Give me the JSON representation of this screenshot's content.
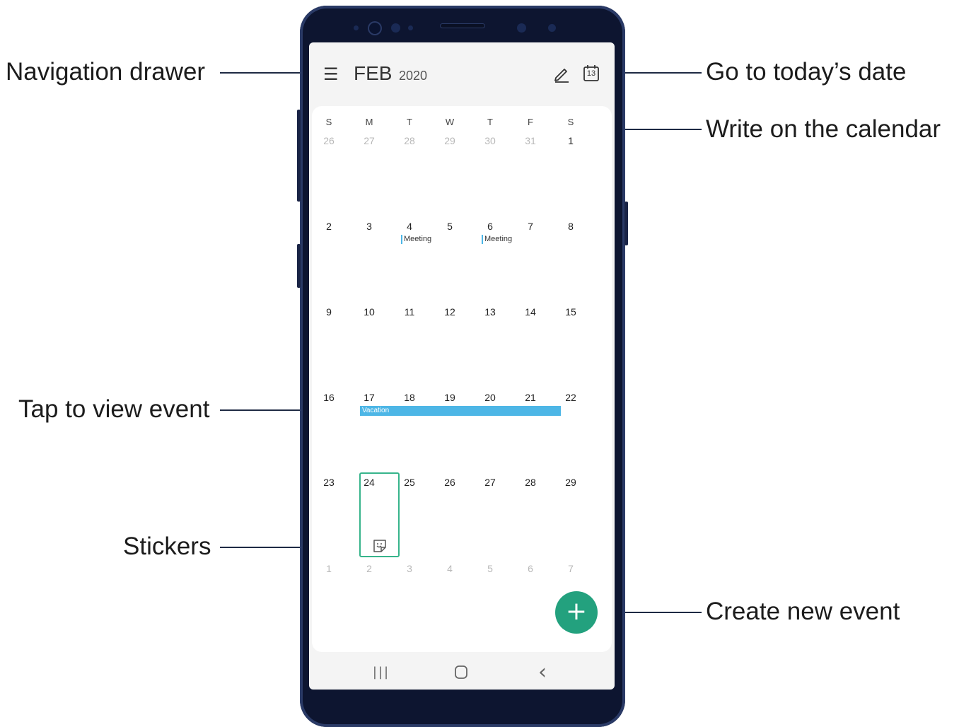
{
  "callouts": {
    "navigation_drawer": "Navigation drawer",
    "go_to_today": "Go to today’s date",
    "write_on_calendar": "Write on the calendar",
    "tap_to_view_event": "Tap to view event",
    "stickers": "Stickers",
    "create_new_event": "Create new event"
  },
  "header": {
    "menu_icon": "☰",
    "month": "FEB",
    "year": "2020",
    "today_icon_number": "13"
  },
  "weekdays": [
    "S",
    "M",
    "T",
    "W",
    "T",
    "F",
    "S"
  ],
  "weeks": [
    [
      "26",
      "27",
      "28",
      "29",
      "30",
      "31",
      "1"
    ],
    [
      "2",
      "3",
      "4",
      "5",
      "6",
      "7",
      "8"
    ],
    [
      "9",
      "10",
      "11",
      "12",
      "13",
      "14",
      "15"
    ],
    [
      "16",
      "17",
      "18",
      "19",
      "20",
      "21",
      "22"
    ],
    [
      "23",
      "24",
      "25",
      "26",
      "27",
      "28",
      "29"
    ],
    [
      "1",
      "2",
      "3",
      "4",
      "5",
      "6",
      "7"
    ]
  ],
  "events": {
    "meeting_1": "Meeting",
    "meeting_2": "Meeting",
    "vacation": "Vacation"
  },
  "fab": {
    "label": "+"
  },
  "navbar": {
    "recents": "|||",
    "home": "○",
    "back": "‹"
  },
  "colors": {
    "accent": "#23a17e",
    "event_blue": "#4db6e6",
    "phone_body": "#0d1530"
  }
}
